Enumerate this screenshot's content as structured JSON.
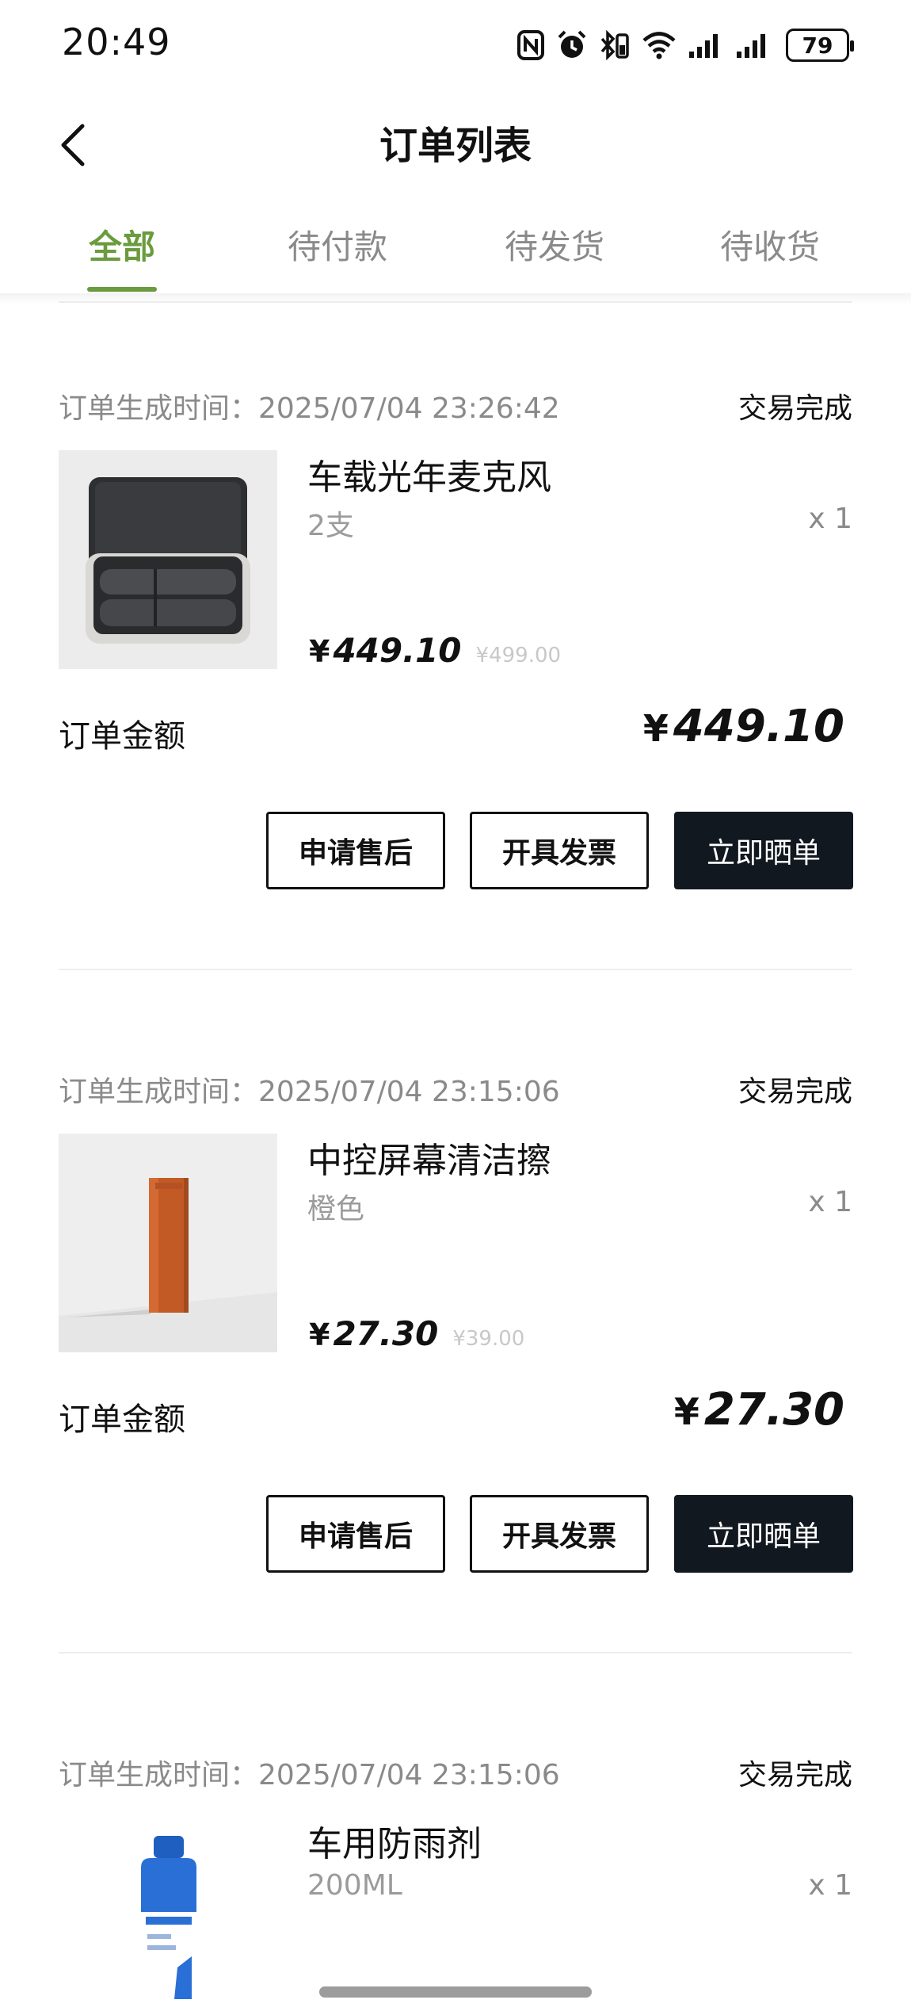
{
  "status_bar": {
    "time": "20:49",
    "battery": "79",
    "icons": [
      "nfc-icon",
      "alarm-icon",
      "bluetooth-battery-icon",
      "wifi-icon",
      "signal-icon",
      "signal-icon-2",
      "battery-icon"
    ]
  },
  "header": {
    "title": "订单列表",
    "back_icon": "chevron-left-icon"
  },
  "tabs": [
    {
      "label": "全部",
      "active": true
    },
    {
      "label": "待付款",
      "active": false
    },
    {
      "label": "待发货",
      "active": false
    },
    {
      "label": "待收货",
      "active": false
    }
  ],
  "accent_color": "#6a9b3e",
  "orders": [
    {
      "created_label": "订单生成时间：",
      "created_time": "2025/07/04 23:26:42",
      "status": "交易完成",
      "product_name": "车载光年麦克风",
      "spec": "2支",
      "qty": "x 1",
      "currency": "¥",
      "price": "449.10",
      "original_price": "¥499.00",
      "amount_label": "订单金额",
      "amount": "449.10",
      "buttons": [
        "申请售后",
        "开具发票",
        "立即晒单"
      ]
    },
    {
      "created_label": "订单生成时间：",
      "created_time": "2025/07/04 23:15:06",
      "status": "交易完成",
      "product_name": "中控屏幕清洁擦",
      "spec": "橙色",
      "qty": "x 1",
      "currency": "¥",
      "price": "27.30",
      "original_price": "¥39.00",
      "amount_label": "订单金额",
      "amount": "27.30",
      "buttons": [
        "申请售后",
        "开具发票",
        "立即晒单"
      ]
    },
    {
      "created_label": "订单生成时间：",
      "created_time": "2025/07/04 23:15:06",
      "status": "交易完成",
      "product_name": "车用防雨剂",
      "spec": "200ML",
      "qty": "x 1"
    }
  ]
}
